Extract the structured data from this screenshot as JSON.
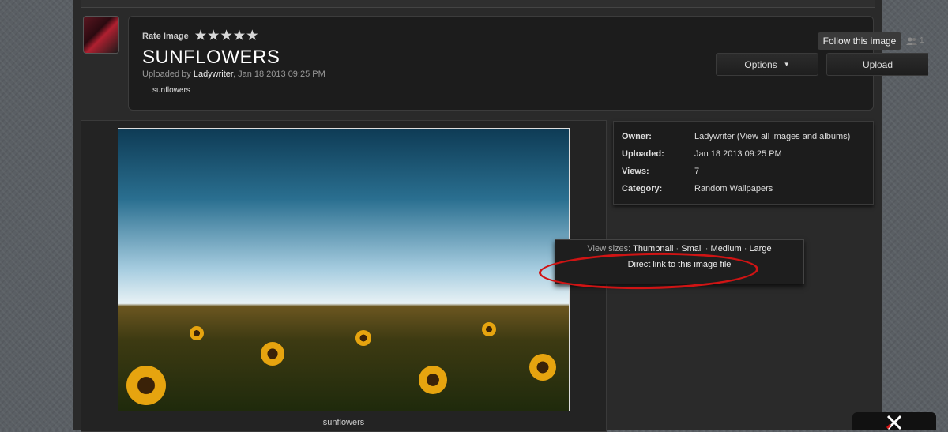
{
  "header": {
    "rate_label": "Rate Image",
    "title": "SUNFLOWERS",
    "uploaded_prefix": "Uploaded by ",
    "uploader": "Ladywriter",
    "uploaded_date": ", Jan 18 2013 09:25 PM",
    "tag": "sunflowers",
    "follow_label": "Follow this image",
    "followers_count": "1",
    "options_label": "Options",
    "upload_label": "Upload",
    "rating_stars": 5
  },
  "image": {
    "caption": "sunflowers"
  },
  "info": {
    "owner_label": "Owner:",
    "owner_value": "Ladywriter (View all images and albums)",
    "uploaded_label": "Uploaded:",
    "uploaded_value": "Jan 18 2013 09:25 PM",
    "views_label": "Views:",
    "views_value": "7",
    "category_label": "Category:",
    "category_value": "Random Wallpapers"
  },
  "popup": {
    "sizes_label": "View sizes: ",
    "thumbnail": "Thumbnail",
    "small": "Small",
    "medium": "Medium",
    "large": "Large",
    "separator": " · ",
    "direct_link": "Direct link to this image file"
  },
  "colors": {
    "highlight_circle": "#d01414",
    "panel_bg": "#1c1c1c"
  }
}
